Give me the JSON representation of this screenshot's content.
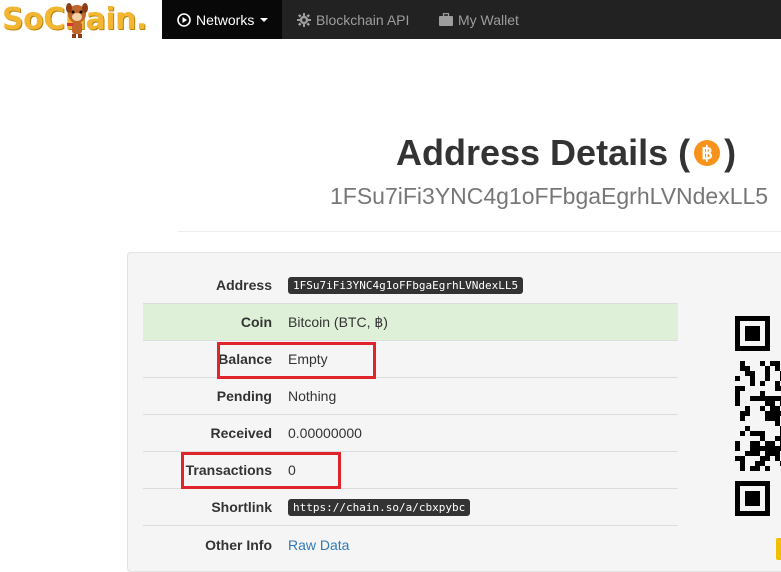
{
  "brand": {
    "name": "SoChain."
  },
  "nav": {
    "items": [
      {
        "label": "Networks",
        "icon": "play-circle-icon",
        "active": true
      },
      {
        "label": "Blockchain API",
        "icon": "gear-icon",
        "active": false
      },
      {
        "label": "My Wallet",
        "icon": "briefcase-icon",
        "active": false
      }
    ]
  },
  "page": {
    "title": "Address Details (",
    "title_close": ")",
    "coin_symbol": "฿",
    "subtitle": "1FSu7iFi3YNC4g1oFFbgaEgrhLVNdexLL5"
  },
  "details": {
    "rows": [
      {
        "label": "Address",
        "value": "1FSu7iFi3YNC4g1oFFbgaEgrhLVNdexLL5"
      },
      {
        "label": "Coin",
        "value": "Bitcoin (BTC, ฿)"
      },
      {
        "label": "Balance",
        "value": "Empty"
      },
      {
        "label": "Pending",
        "value": "Nothing"
      },
      {
        "label": "Received",
        "value": "0.00000000"
      },
      {
        "label": "Transactions",
        "value": "0"
      },
      {
        "label": "Shortlink",
        "value": "https://chain.so/a/cbxpybc"
      },
      {
        "label": "Other Info",
        "value": "Raw Data"
      }
    ]
  },
  "colors": {
    "navbar": "#222222",
    "highlight": "#e0242b",
    "success_row": "#dff0d8",
    "link": "#337ab7",
    "bitcoin": "#f7931a"
  }
}
